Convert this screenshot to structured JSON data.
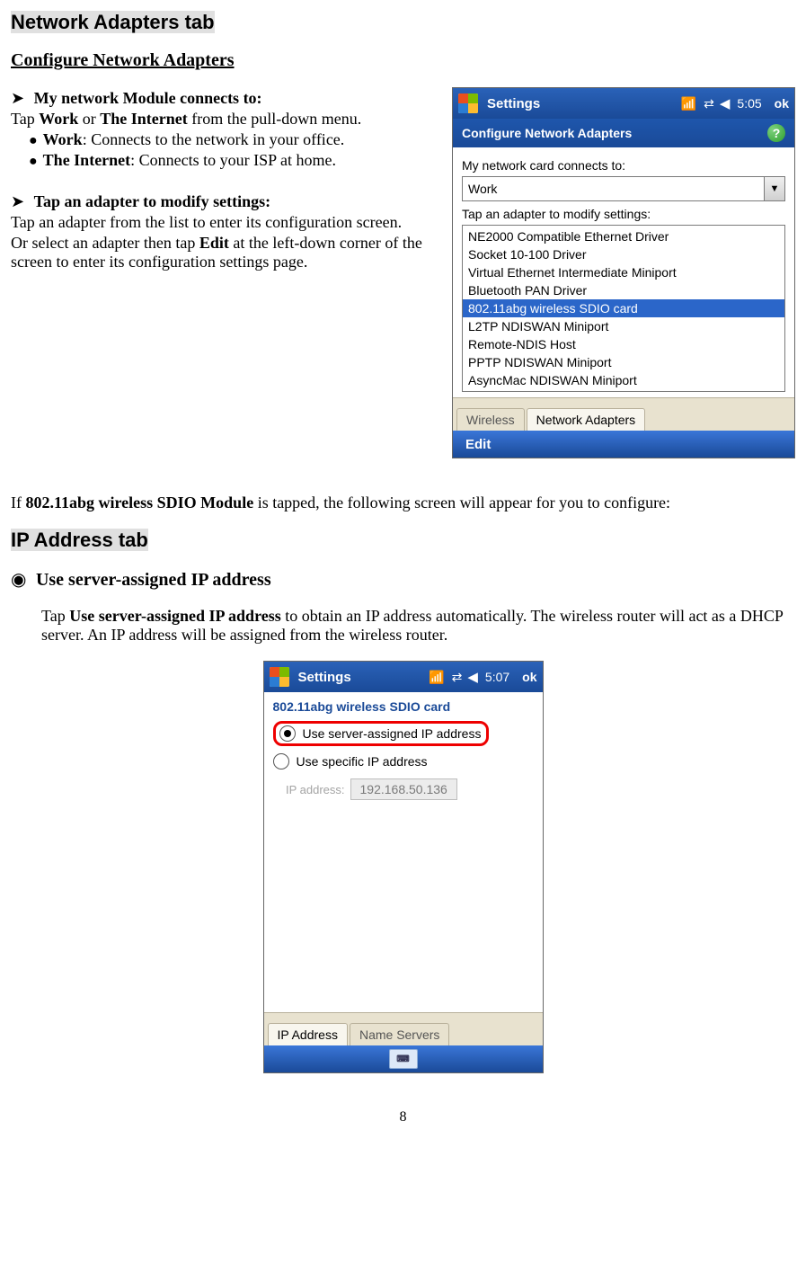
{
  "headings": {
    "network_adapters_tab": "Network Adapters tab",
    "configure": "Configure Network Adapters",
    "ip_address_tab": "IP Address tab"
  },
  "section1": {
    "item1_title": "My network Module connects to:",
    "item1_line1a": "Tap ",
    "item1_line1b": "Work",
    "item1_line1c": " or ",
    "item1_line1d": "The Internet",
    "item1_line1e": " from the pull-down menu.",
    "bullet1a": "Work",
    "bullet1b": ": Connects to the network in your office.",
    "bullet2a": "The Internet",
    "bullet2b": ": Connects to your ISP at home.",
    "item2_title": "Tap an adapter to modify settings:",
    "item2_line1": "Tap an adapter from the list to enter its configuration screen.",
    "item2_line2a": "Or select an adapter then tap ",
    "item2_line2b": "Edit",
    "item2_line2c": " at the left-down corner of the screen to enter its configuration settings page."
  },
  "midtext": {
    "a": "If ",
    "b": "802.11abg wireless SDIO Module",
    "c": " is tapped, the following screen will appear for you to configure:"
  },
  "section2": {
    "title": "Use server-assigned IP address",
    "line1a": "Tap ",
    "line1b": "Use server-assigned IP address",
    "line1c": " to obtain an IP address automatically. The wireless router will act as a DHCP server. An IP address will be assigned from the wireless router."
  },
  "device1": {
    "titlebar": "Settings",
    "time": "5:05",
    "ok": "ok",
    "subhead": "Configure Network Adapters",
    "label_connects": "My network card connects to:",
    "combo_value": "Work",
    "label_tap": "Tap an adapter to modify settings:",
    "adapters": [
      "NE2000 Compatible Ethernet Driver",
      "Socket 10-100 Driver",
      "Virtual Ethernet Intermediate Miniport",
      "Bluetooth PAN Driver",
      "802.11abg wireless SDIO card",
      "L2TP NDISWAN Miniport",
      "Remote-NDIS Host",
      "PPTP NDISWAN Miniport",
      "AsyncMac NDISWAN Miniport"
    ],
    "selected_index": 4,
    "tab1": "Wireless",
    "tab2": "Network Adapters",
    "edit": "Edit"
  },
  "device2": {
    "titlebar": "Settings",
    "time": "5:07",
    "ok": "ok",
    "cardname": "802.11abg wireless SDIO card",
    "radio1": "Use server-assigned IP address",
    "radio2": "Use specific IP address",
    "ip_label": "IP address:",
    "ip_value": "192.168.50.136",
    "tab1": "IP Address",
    "tab2": "Name Servers"
  },
  "page_number": "8"
}
